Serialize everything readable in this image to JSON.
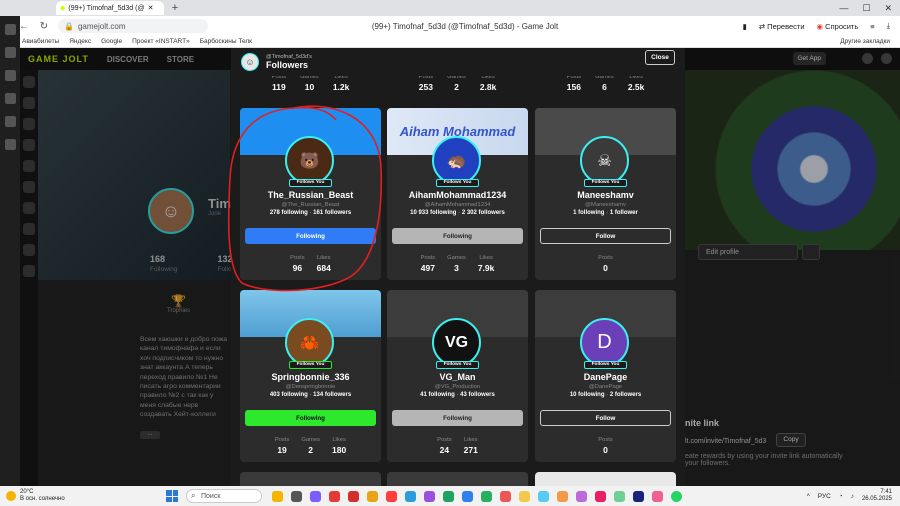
{
  "browser": {
    "tab_title": "(99+) Timofnaf_5d3d (@",
    "address": "gamejolt.com",
    "page_title": "(99+) Timofnaf_5d3d (@Timofnaf_5d3d) - Game Jolt",
    "translate": "Перевести",
    "ask": "Спросить",
    "bookmarks": [
      "Авиабилеты",
      "Яндекс",
      "Google",
      "Проект «INSTART»",
      "Барбоскины Телк"
    ],
    "other_bookmarks": "Другие закладки"
  },
  "site": {
    "logo": "GAME JOLT",
    "nav": [
      "DISCOVER",
      "STORE"
    ],
    "get_app": "Get App",
    "profile_name": "Tim",
    "profile_sub": "Jone",
    "profile_stats": [
      {
        "value": "168",
        "label": "Following"
      },
      {
        "value": "132",
        "label": "Followers"
      }
    ],
    "trophies_label": "Trophies",
    "bio": "Всем хаюшки и добро пожа канал тимофнафа и если хоч подписчиком то нужно знат аккаунта А теперь переход правило №1 Не писать агро комментарии правило №2 с так как у меня слабые нерв создавать Хейт-коллеги",
    "bio_more": "...",
    "edit_profile": "Edit profile",
    "invite_title": "nite link",
    "invite_url": "lt.com/invite/Timofnaf_5d3",
    "invite_desc": "eate rewards by using your invite link automatically your followers.",
    "copy": "Copy"
  },
  "modal": {
    "user": "@Timofnaf_5d3d's",
    "title": "Followers",
    "close": "Close",
    "top_row": [
      {
        "stats": [
          {
            "label": "Posts",
            "value": "119"
          },
          {
            "label": "Games",
            "value": "10"
          },
          {
            "label": "Likes",
            "value": "1.2k"
          }
        ]
      },
      {
        "stats": [
          {
            "label": "Posts",
            "value": "253"
          },
          {
            "label": "Games",
            "value": "2"
          },
          {
            "label": "Likes",
            "value": "2.8k"
          }
        ]
      },
      {
        "stats": [
          {
            "label": "Posts",
            "value": "156"
          },
          {
            "label": "Games",
            "value": "6"
          },
          {
            "label": "Likes",
            "value": "2.5k"
          }
        ]
      }
    ],
    "cards": [
      {
        "name": "The_Russian_Beast",
        "handle": "@The_Russian_Beast",
        "following": "278 following",
        "followers": "161 followers",
        "button": "Following",
        "badge": "Follows You",
        "stats": [
          {
            "label": "Posts",
            "value": "96"
          },
          {
            "label": "Likes",
            "value": "684"
          }
        ]
      },
      {
        "name": "AihamMohammad1234",
        "handle": "@AihamMohammad1234",
        "following": "10 933 following",
        "followers": "2 302 followers",
        "button": "Following",
        "badge": "Follows You",
        "banner_text": "Aiham Mohammad",
        "stats": [
          {
            "label": "Posts",
            "value": "497"
          },
          {
            "label": "Games",
            "value": "3"
          },
          {
            "label": "Likes",
            "value": "7.9k"
          }
        ]
      },
      {
        "name": "Maneeshamv",
        "handle": "@Maneeshamv",
        "following": "1 following",
        "followers": "1 follower",
        "button": "Follow",
        "badge": "Follows You",
        "stats": [
          {
            "label": "Posts",
            "value": "0"
          }
        ]
      },
      {
        "name": "Springbonnie_336",
        "handle": "@Denspringbonnie",
        "following": "403 following",
        "followers": "134 followers",
        "button": "Following",
        "badge": "Follows You",
        "stats": [
          {
            "label": "Posts",
            "value": "19"
          },
          {
            "label": "Games",
            "value": "2"
          },
          {
            "label": "Likes",
            "value": "180"
          }
        ]
      },
      {
        "name": "VG_Man",
        "handle": "@VG_Production",
        "following": "41 following",
        "followers": "43 followers",
        "button": "Following",
        "badge": "Follows You",
        "avatar_text": "VG",
        "stats": [
          {
            "label": "Posts",
            "value": "24"
          },
          {
            "label": "Likes",
            "value": "271"
          }
        ]
      },
      {
        "name": "DanePage",
        "handle": "@DanePage",
        "following": "10 following",
        "followers": "2 followers",
        "button": "Follow",
        "badge": "Follows You",
        "avatar_text": "D",
        "stats": [
          {
            "label": "Posts",
            "value": "0"
          }
        ]
      }
    ]
  },
  "taskbar": {
    "temp": "20°C",
    "weather": "В осн. солнечно",
    "search": "Поиск",
    "lang": "РУС",
    "time": "7:41",
    "date": "26.05.2025"
  },
  "colors": {
    "accent_cyan": "#3bf0f0",
    "follow_blue": "#2f7cf6",
    "follow_green": "#2ee82e",
    "annotation_red": "#e02020"
  }
}
